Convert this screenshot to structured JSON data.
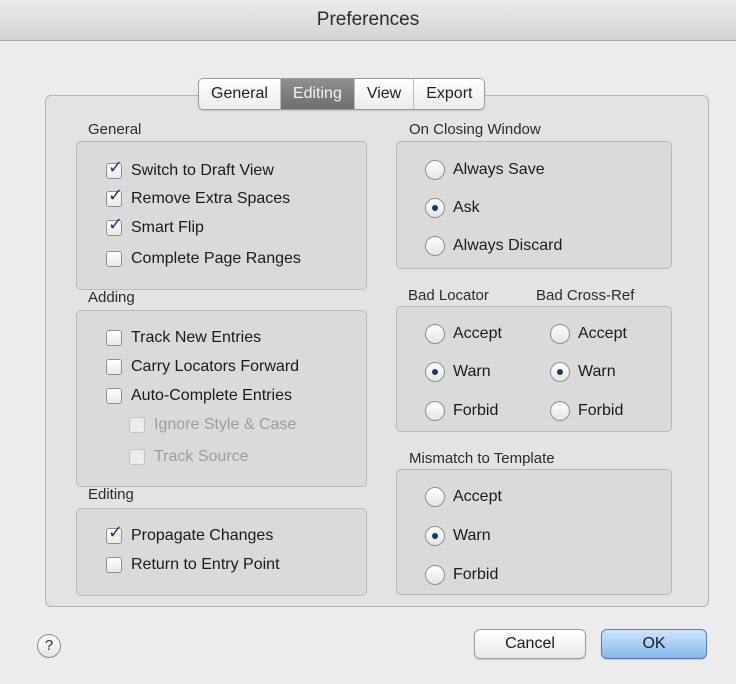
{
  "window": {
    "title": "Preferences"
  },
  "tabs": [
    {
      "label": "General",
      "active": false
    },
    {
      "label": "Editing",
      "active": true
    },
    {
      "label": "View",
      "active": false
    },
    {
      "label": "Export",
      "active": false
    }
  ],
  "general": {
    "label": "General",
    "items": [
      {
        "label": "Switch to Draft View",
        "checked": true
      },
      {
        "label": "Remove Extra Spaces",
        "checked": true
      },
      {
        "label": "Smart Flip",
        "checked": true
      },
      {
        "label": "Complete Page Ranges",
        "checked": false
      }
    ]
  },
  "adding": {
    "label": "Adding",
    "items": [
      {
        "label": "Track New Entries",
        "checked": false,
        "enabled": true
      },
      {
        "label": "Carry Locators Forward",
        "checked": false,
        "enabled": true
      },
      {
        "label": "Auto-Complete Entries",
        "checked": false,
        "enabled": true
      },
      {
        "label": "Ignore Style & Case",
        "checked": false,
        "enabled": false
      },
      {
        "label": "Track Source",
        "checked": false,
        "enabled": false
      }
    ]
  },
  "editing": {
    "label": "Editing",
    "items": [
      {
        "label": "Propagate Changes",
        "checked": true
      },
      {
        "label": "Return to Entry Point",
        "checked": false
      }
    ]
  },
  "on_closing": {
    "label": "On Closing Window",
    "options": [
      "Always Save",
      "Ask",
      "Always Discard"
    ],
    "selected": "Ask"
  },
  "bad_locator": {
    "label": "Bad Locator",
    "options": [
      "Accept",
      "Warn",
      "Forbid"
    ],
    "selected": "Warn"
  },
  "bad_crossref": {
    "label": "Bad Cross-Ref",
    "options": [
      "Accept",
      "Warn",
      "Forbid"
    ],
    "selected": "Warn"
  },
  "mismatch": {
    "label": "Mismatch to Template",
    "options": [
      "Accept",
      "Warn",
      "Forbid"
    ],
    "selected": "Warn"
  },
  "footer": {
    "help": "?",
    "cancel": "Cancel",
    "ok": "OK"
  },
  "colors": {
    "accent": "#86b9ec",
    "checkmark": "#1f3c78",
    "active_tab": "#7f7f7f"
  }
}
